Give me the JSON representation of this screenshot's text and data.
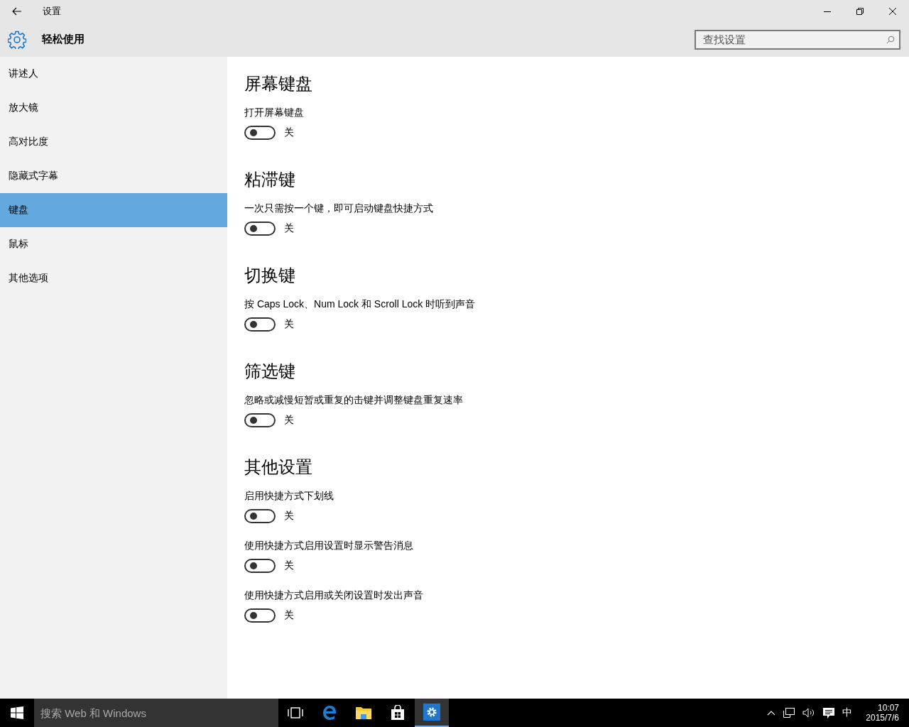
{
  "window": {
    "title": "设置"
  },
  "header": {
    "title": "轻松使用",
    "search": {
      "placeholder": "查找设置"
    }
  },
  "sidebar": {
    "items": [
      {
        "label": "讲述人",
        "selected": false
      },
      {
        "label": "放大镜",
        "selected": false
      },
      {
        "label": "高对比度",
        "selected": false
      },
      {
        "label": "隐藏式字幕",
        "selected": false
      },
      {
        "label": "键盘",
        "selected": true
      },
      {
        "label": "鼠标",
        "selected": false
      },
      {
        "label": "其他选项",
        "selected": false
      }
    ]
  },
  "sections": [
    {
      "title": "屏幕键盘",
      "settings": [
        {
          "label": "打开屏幕键盘",
          "on": false,
          "state_label": "关"
        }
      ]
    },
    {
      "title": "粘滞键",
      "settings": [
        {
          "label": "一次只需按一个键，即可启动键盘快捷方式",
          "on": false,
          "state_label": "关"
        }
      ]
    },
    {
      "title": "切换键",
      "settings": [
        {
          "label": "按 Caps Lock、Num Lock 和 Scroll Lock 时听到声音",
          "on": false,
          "state_label": "关"
        }
      ]
    },
    {
      "title": "筛选键",
      "settings": [
        {
          "label": "忽略或减慢短暂或重复的击键并调整键盘重复速率",
          "on": false,
          "state_label": "关"
        }
      ]
    },
    {
      "title": "其他设置",
      "settings": [
        {
          "label": "启用快捷方式下划线",
          "on": false,
          "state_label": "关"
        },
        {
          "label": "使用快捷方式启用设置时显示警告消息",
          "on": false,
          "state_label": "关"
        },
        {
          "label": "使用快捷方式启用或关闭设置时发出声音",
          "on": false,
          "state_label": "关"
        }
      ]
    }
  ],
  "taskbar": {
    "search": {
      "placeholder": "搜索 Web 和 Windows"
    },
    "ime": "中",
    "time": "10:07",
    "date": "2015/7/6"
  }
}
